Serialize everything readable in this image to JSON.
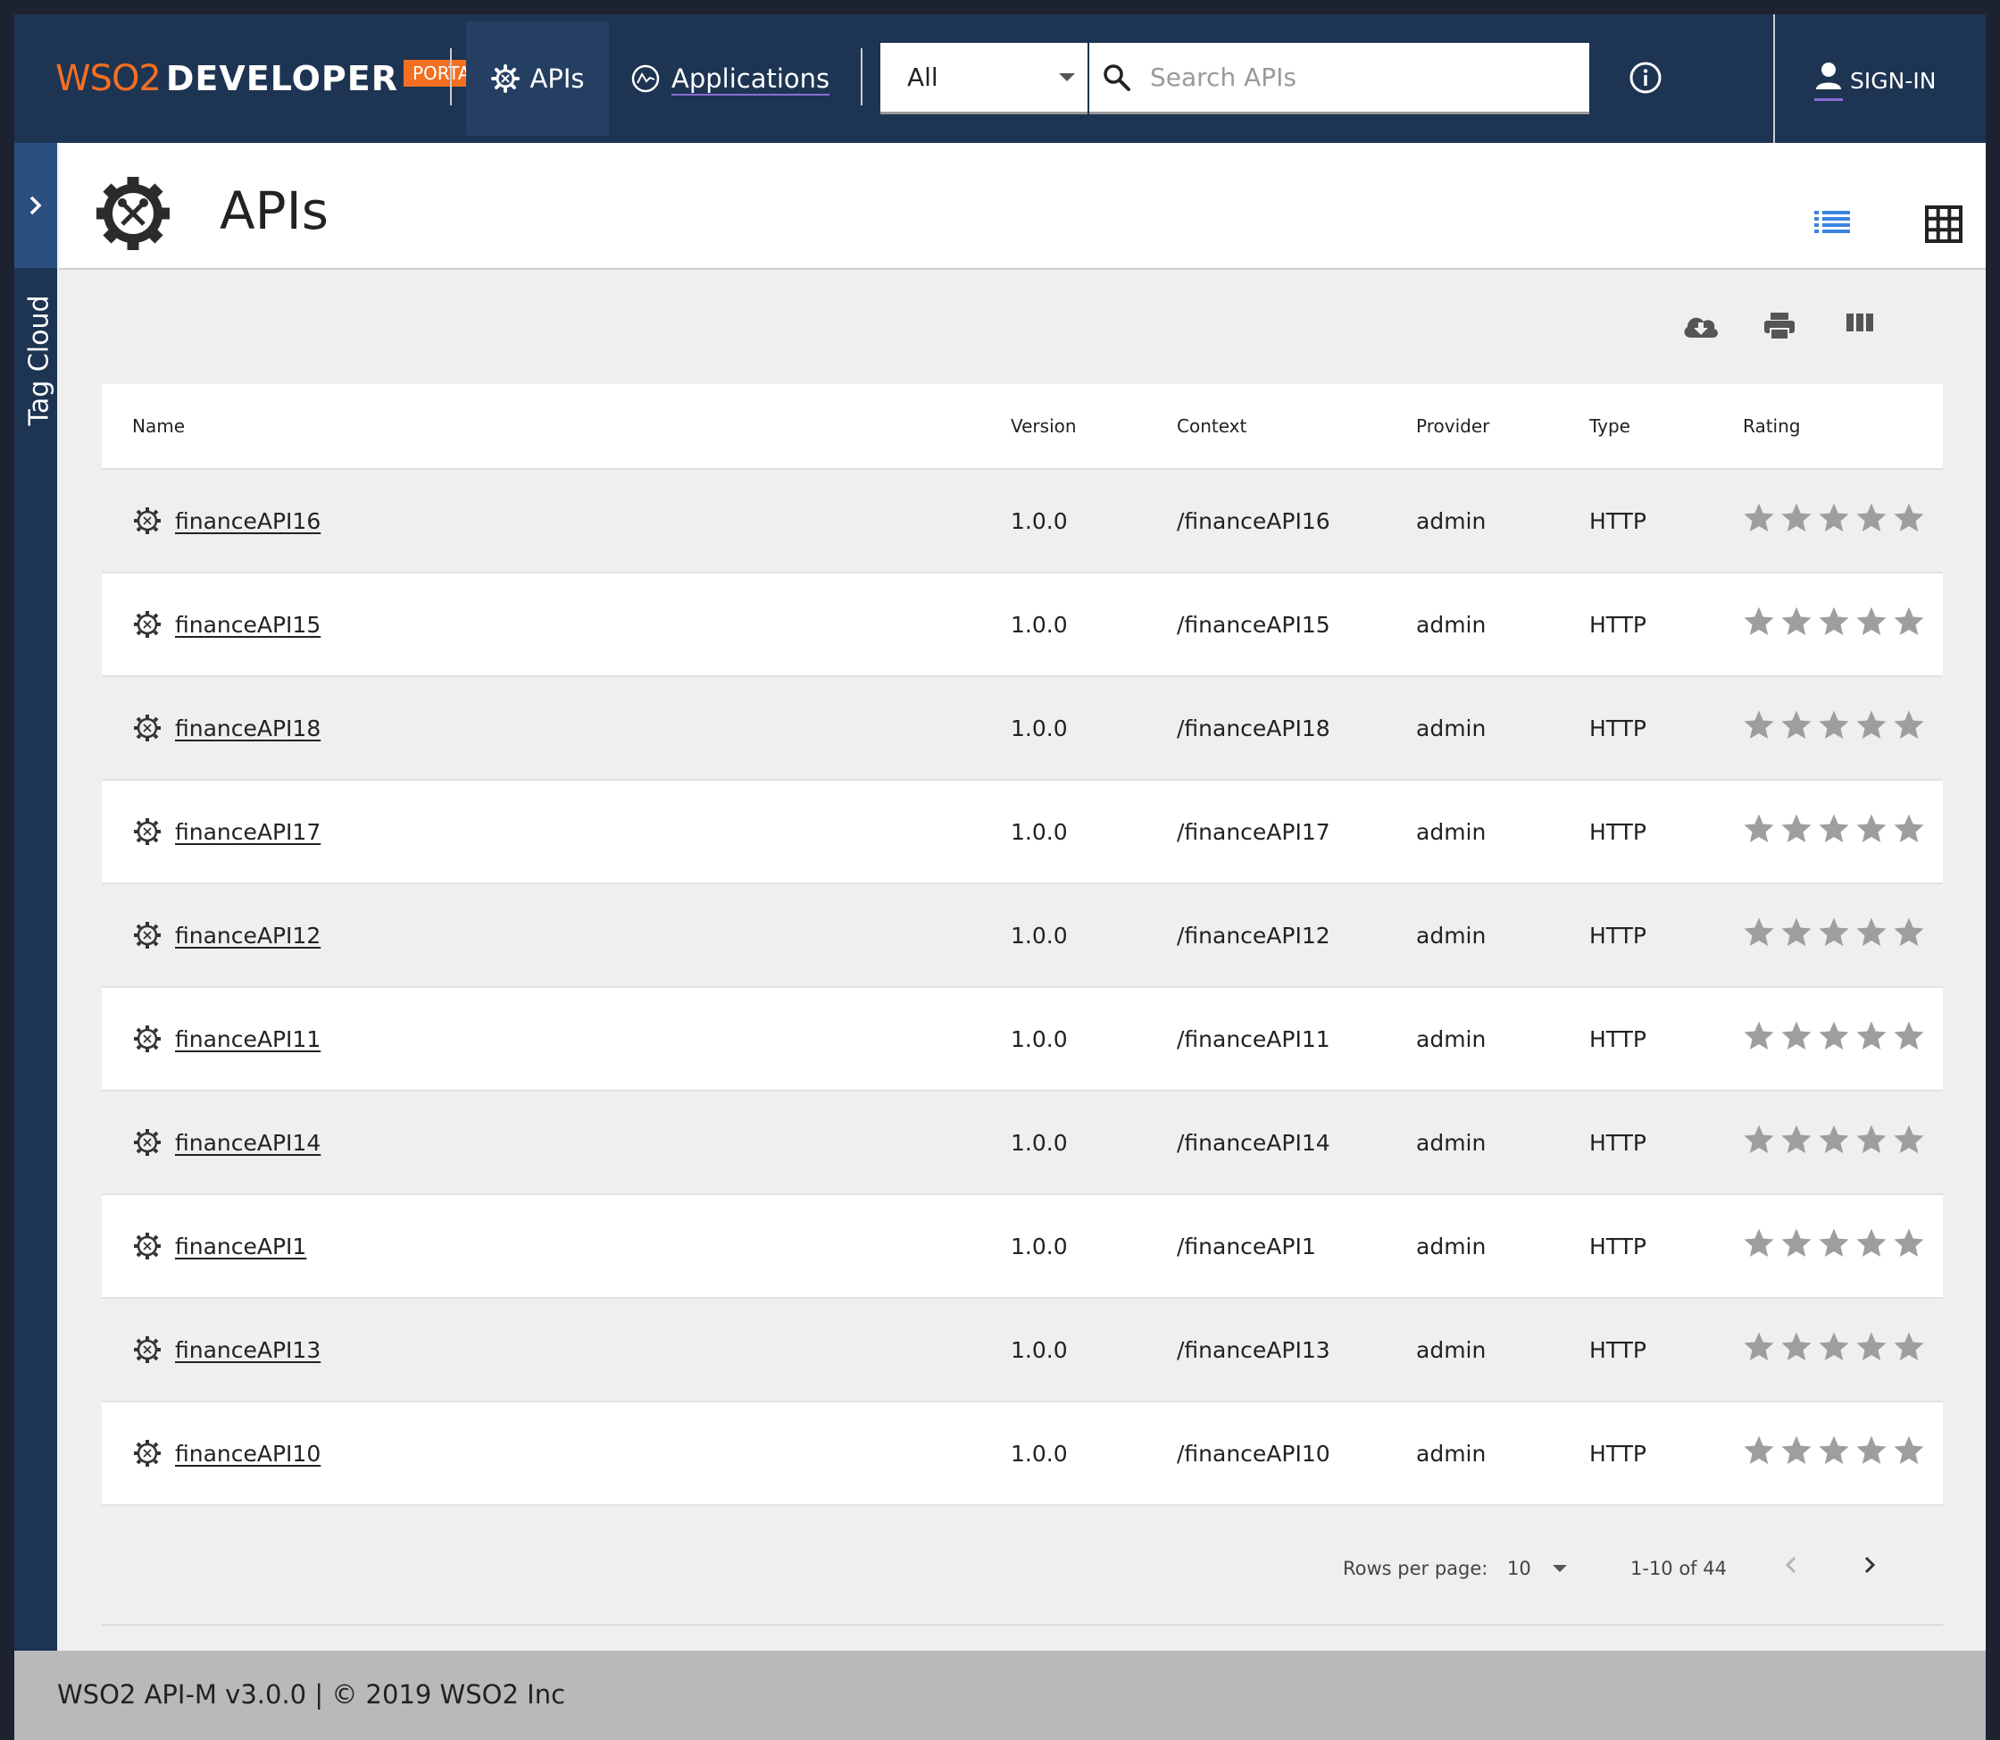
{
  "header": {
    "logo": {
      "wso2": "WSO2",
      "developer": "DEVELOPER",
      "portal": "PORTAL"
    },
    "nav": [
      {
        "label": "APIs",
        "icon": "gear-icon",
        "active": true
      },
      {
        "label": "Applications",
        "icon": "applications-icon",
        "active": false
      }
    ],
    "scope_select": {
      "value": "All"
    },
    "search": {
      "placeholder": "Search APIs"
    },
    "signin_label": "SIGN-IN"
  },
  "sidebar": {
    "tag_cloud_label": "Tag Cloud"
  },
  "page": {
    "title": "APIs"
  },
  "table": {
    "columns": [
      "Name",
      "Version",
      "Context",
      "Provider",
      "Type",
      "Rating"
    ],
    "rows": [
      {
        "name": "financeAPI16",
        "version": "1.0.0",
        "context": "/financeAPI16",
        "provider": "admin",
        "type": "HTTP",
        "rating": 0
      },
      {
        "name": "financeAPI15",
        "version": "1.0.0",
        "context": "/financeAPI15",
        "provider": "admin",
        "type": "HTTP",
        "rating": 0
      },
      {
        "name": "financeAPI18",
        "version": "1.0.0",
        "context": "/financeAPI18",
        "provider": "admin",
        "type": "HTTP",
        "rating": 0
      },
      {
        "name": "financeAPI17",
        "version": "1.0.0",
        "context": "/financeAPI17",
        "provider": "admin",
        "type": "HTTP",
        "rating": 0
      },
      {
        "name": "financeAPI12",
        "version": "1.0.0",
        "context": "/financeAPI12",
        "provider": "admin",
        "type": "HTTP",
        "rating": 0
      },
      {
        "name": "financeAPI11",
        "version": "1.0.0",
        "context": "/financeAPI11",
        "provider": "admin",
        "type": "HTTP",
        "rating": 0
      },
      {
        "name": "financeAPI14",
        "version": "1.0.0",
        "context": "/financeAPI14",
        "provider": "admin",
        "type": "HTTP",
        "rating": 0
      },
      {
        "name": "financeAPI1",
        "version": "1.0.0",
        "context": "/financeAPI1",
        "provider": "admin",
        "type": "HTTP",
        "rating": 0
      },
      {
        "name": "financeAPI13",
        "version": "1.0.0",
        "context": "/financeAPI13",
        "provider": "admin",
        "type": "HTTP",
        "rating": 0
      },
      {
        "name": "financeAPI10",
        "version": "1.0.0",
        "context": "/financeAPI10",
        "provider": "admin",
        "type": "HTTP",
        "rating": 0
      }
    ]
  },
  "pagination": {
    "rows_per_page_label": "Rows per page:",
    "rows_per_page": "10",
    "range": "1-10 of 44"
  },
  "footer": {
    "text": "WSO2 API-M v3.0.0 | © 2019 WSO2 Inc"
  },
  "colors": {
    "nav_bg": "#1d3452",
    "accent_orange": "#f36f21",
    "list_icon_blue": "#3b83e0",
    "star_gray": "#9e9e9e"
  }
}
